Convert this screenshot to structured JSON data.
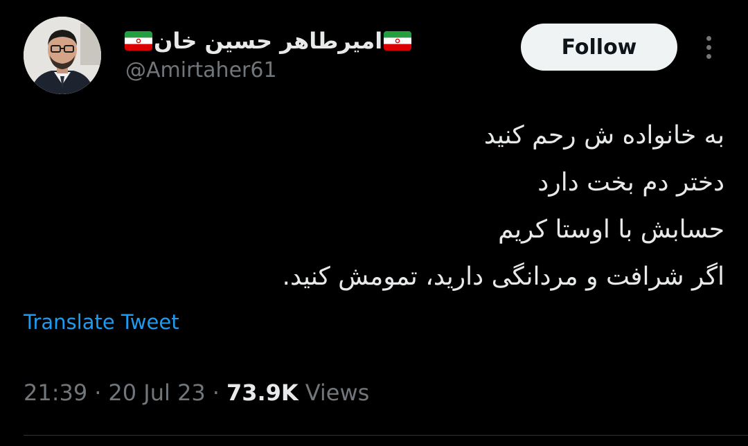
{
  "author": {
    "display_name": "امیرطاهر حسین خان",
    "handle": "@Amirtaher61",
    "avatar_icon": "profile-photo",
    "flag_icon": "iran-flag-emoji"
  },
  "actions": {
    "follow_label": "Follow",
    "more_icon": "more-vertical-icon"
  },
  "tweet": {
    "lines": [
      "به خانواده ش رحم کنید",
      "دختر دم بخت دارد",
      "حسابش با اوستا کریم",
      "اگر شرافت و مردانگی دارید، تمومش کنید."
    ],
    "translate_label": "Translate Tweet"
  },
  "meta": {
    "time": "21:39",
    "separator": "·",
    "date": "20 Jul 23",
    "views_count": "73.9K",
    "views_label": "Views"
  },
  "colors": {
    "background": "#000000",
    "text_primary": "#e7e9ea",
    "text_secondary": "#71767b",
    "link": "#1d9bf0",
    "follow_bg": "#eff3f4"
  }
}
